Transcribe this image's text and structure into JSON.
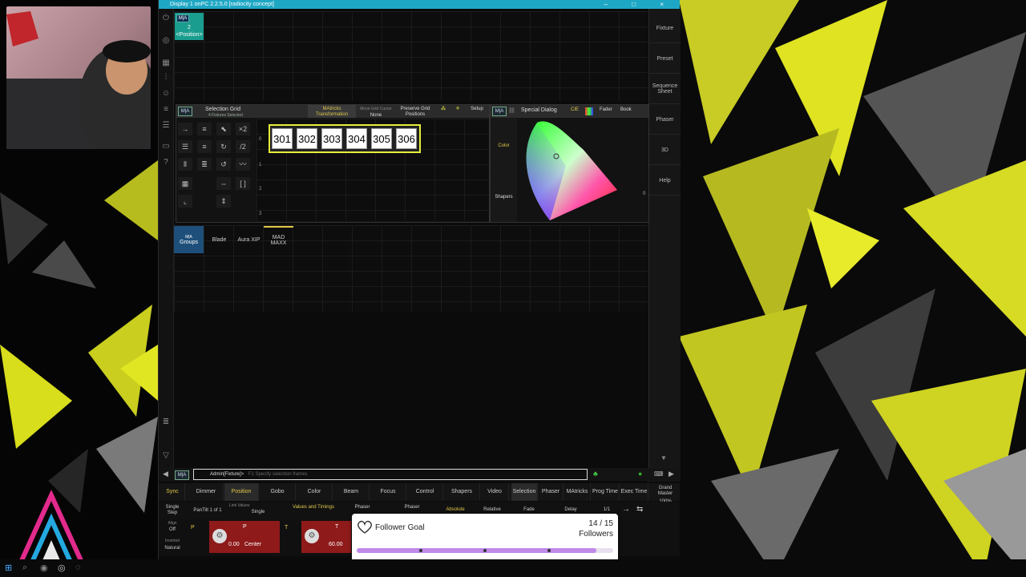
{
  "window": {
    "title": "Display 1 onPC 2.2.5.0 [radiocity concept]",
    "controls": [
      "–",
      "□",
      "×"
    ]
  },
  "top_grid": {
    "position_cell": {
      "number": "2",
      "label": "<Position>",
      "badge": "M|A"
    }
  },
  "right_bar": [
    "Fixture",
    "Preset",
    "Sequence Sheet",
    "Phaser",
    "3D",
    "Help"
  ],
  "selection_grid": {
    "badge": "M|A",
    "title": "Selection Grid",
    "subtitle": "4 Fixtures Selected",
    "matricks": "MAtricks Transformation",
    "mode_label": "Move Grid Cursor",
    "mode_value": "None",
    "preserve": "Preserve Grid Positions",
    "setup": "Setup",
    "row_labels": [
      "0",
      "1",
      "2",
      "3"
    ],
    "fixtures": [
      "301",
      "302",
      "303",
      "304",
      "305",
      "306"
    ]
  },
  "special_dialog": {
    "badge": "M|A",
    "title": "Special Dialog",
    "cie_tab": "CIE",
    "fader_tab": "Fader",
    "book_tab": "Book",
    "side": [
      "Color",
      "Shapers"
    ],
    "zero": "0"
  },
  "groups": {
    "badge": "M|A",
    "label": "Groups",
    "items": [
      "Blade",
      "Aura XIP",
      "MAD MAXX"
    ]
  },
  "command_line": {
    "badge": "M|A",
    "prompt": "Admin[Fixture]>",
    "hint": "F1 Specify selection frames"
  },
  "feature_tabs": [
    "Sync",
    "Dimmer",
    "Position",
    "Gobo",
    "Color",
    "Beam",
    "Focus",
    "Control",
    "Shapers",
    "Video",
    "Selection",
    "Phaser",
    "MAtricks",
    "Prog Time",
    "Exec Time"
  ],
  "grand_master": {
    "label": "Grand Master",
    "value": "100%"
  },
  "row2": {
    "single_step": "Single Step",
    "pantilt": "PanTilt 1 of 1",
    "link_label": "Link Values",
    "link_value": "Single",
    "values_timings": "Values and Timings",
    "phaser1": "Phaser",
    "phaser2": "Phaser",
    "absolute": "Absolute",
    "relative": "Relative",
    "fade": "Fade",
    "delay": "Delay",
    "page": "1/1"
  },
  "row3": {
    "align_label": "Align",
    "align_value": "Off",
    "invert_label": "Inverted",
    "invert_value": "Natural",
    "p_label": "P",
    "p_value": "0.00",
    "p_mode": "Center",
    "t_label": "T",
    "t_value": "60.00"
  },
  "follower_goal": {
    "title": "Follower Goal",
    "count": "14 / 15",
    "unit": "Followers",
    "progress": 0.933,
    "fill_color": "#c08ae8"
  }
}
